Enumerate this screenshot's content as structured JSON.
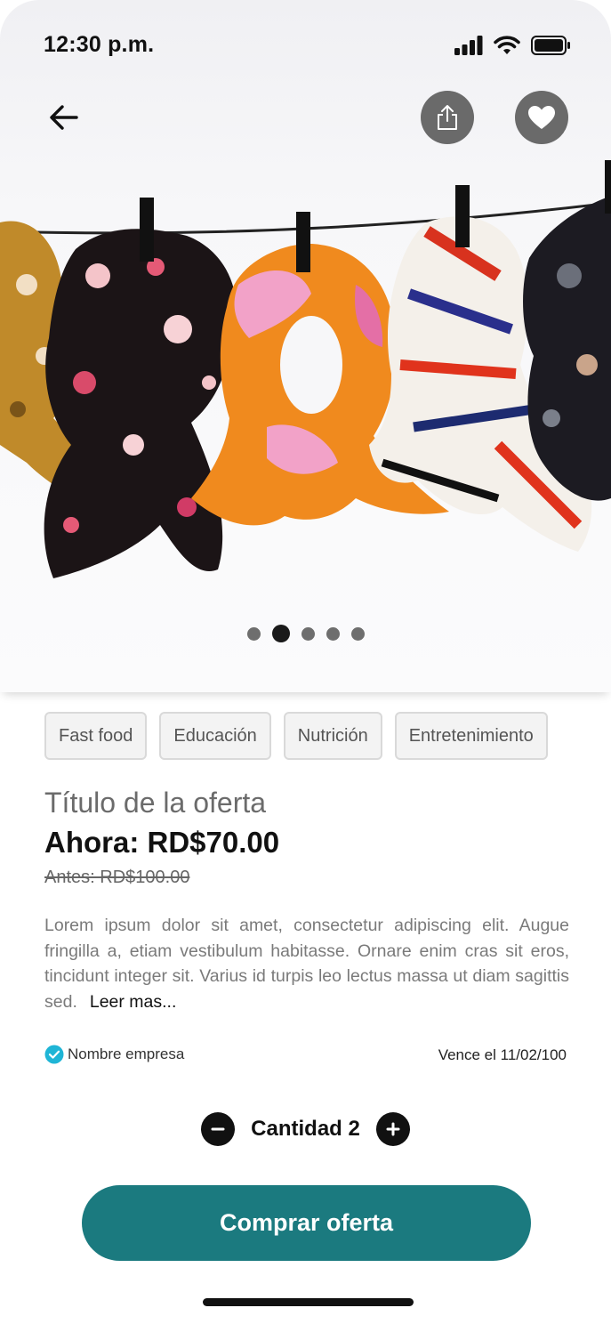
{
  "status_bar": {
    "time": "12:30 p.m."
  },
  "carousel": {
    "slide_count": 5,
    "active_index": 1
  },
  "tags": [
    "Fast food",
    "Educación",
    "Nutrición",
    "Entretenimiento"
  ],
  "offer": {
    "title": "Título de la oferta",
    "price_now": "Ahora: RD$70.00",
    "price_before": "Antes: RD$100.00",
    "description": "Lorem ipsum dolor sit amet, consectetur adipiscing elit. Augue fringilla a, etiam vestibulum habitasse. Ornare enim cras sit eros, tincidunt integer sit. Varius id turpis leo lectus massa ut diam sagittis sed.",
    "read_more": "Leer mas...",
    "company": "Nombre empresa",
    "expires": "Vence el 11/02/100"
  },
  "quantity": {
    "label": "Cantidad 2",
    "value": 2
  },
  "actions": {
    "buy": "Comprar oferta"
  },
  "colors": {
    "accent": "#1b7a7f",
    "verified": "#1fb5d6",
    "icon_button": "#6a6a6a"
  },
  "icons": {
    "back": "arrow-left-icon",
    "share": "share-icon",
    "favorite": "heart-icon",
    "verified": "check-badge-icon",
    "decrease": "minus-icon",
    "increase": "plus-icon"
  }
}
